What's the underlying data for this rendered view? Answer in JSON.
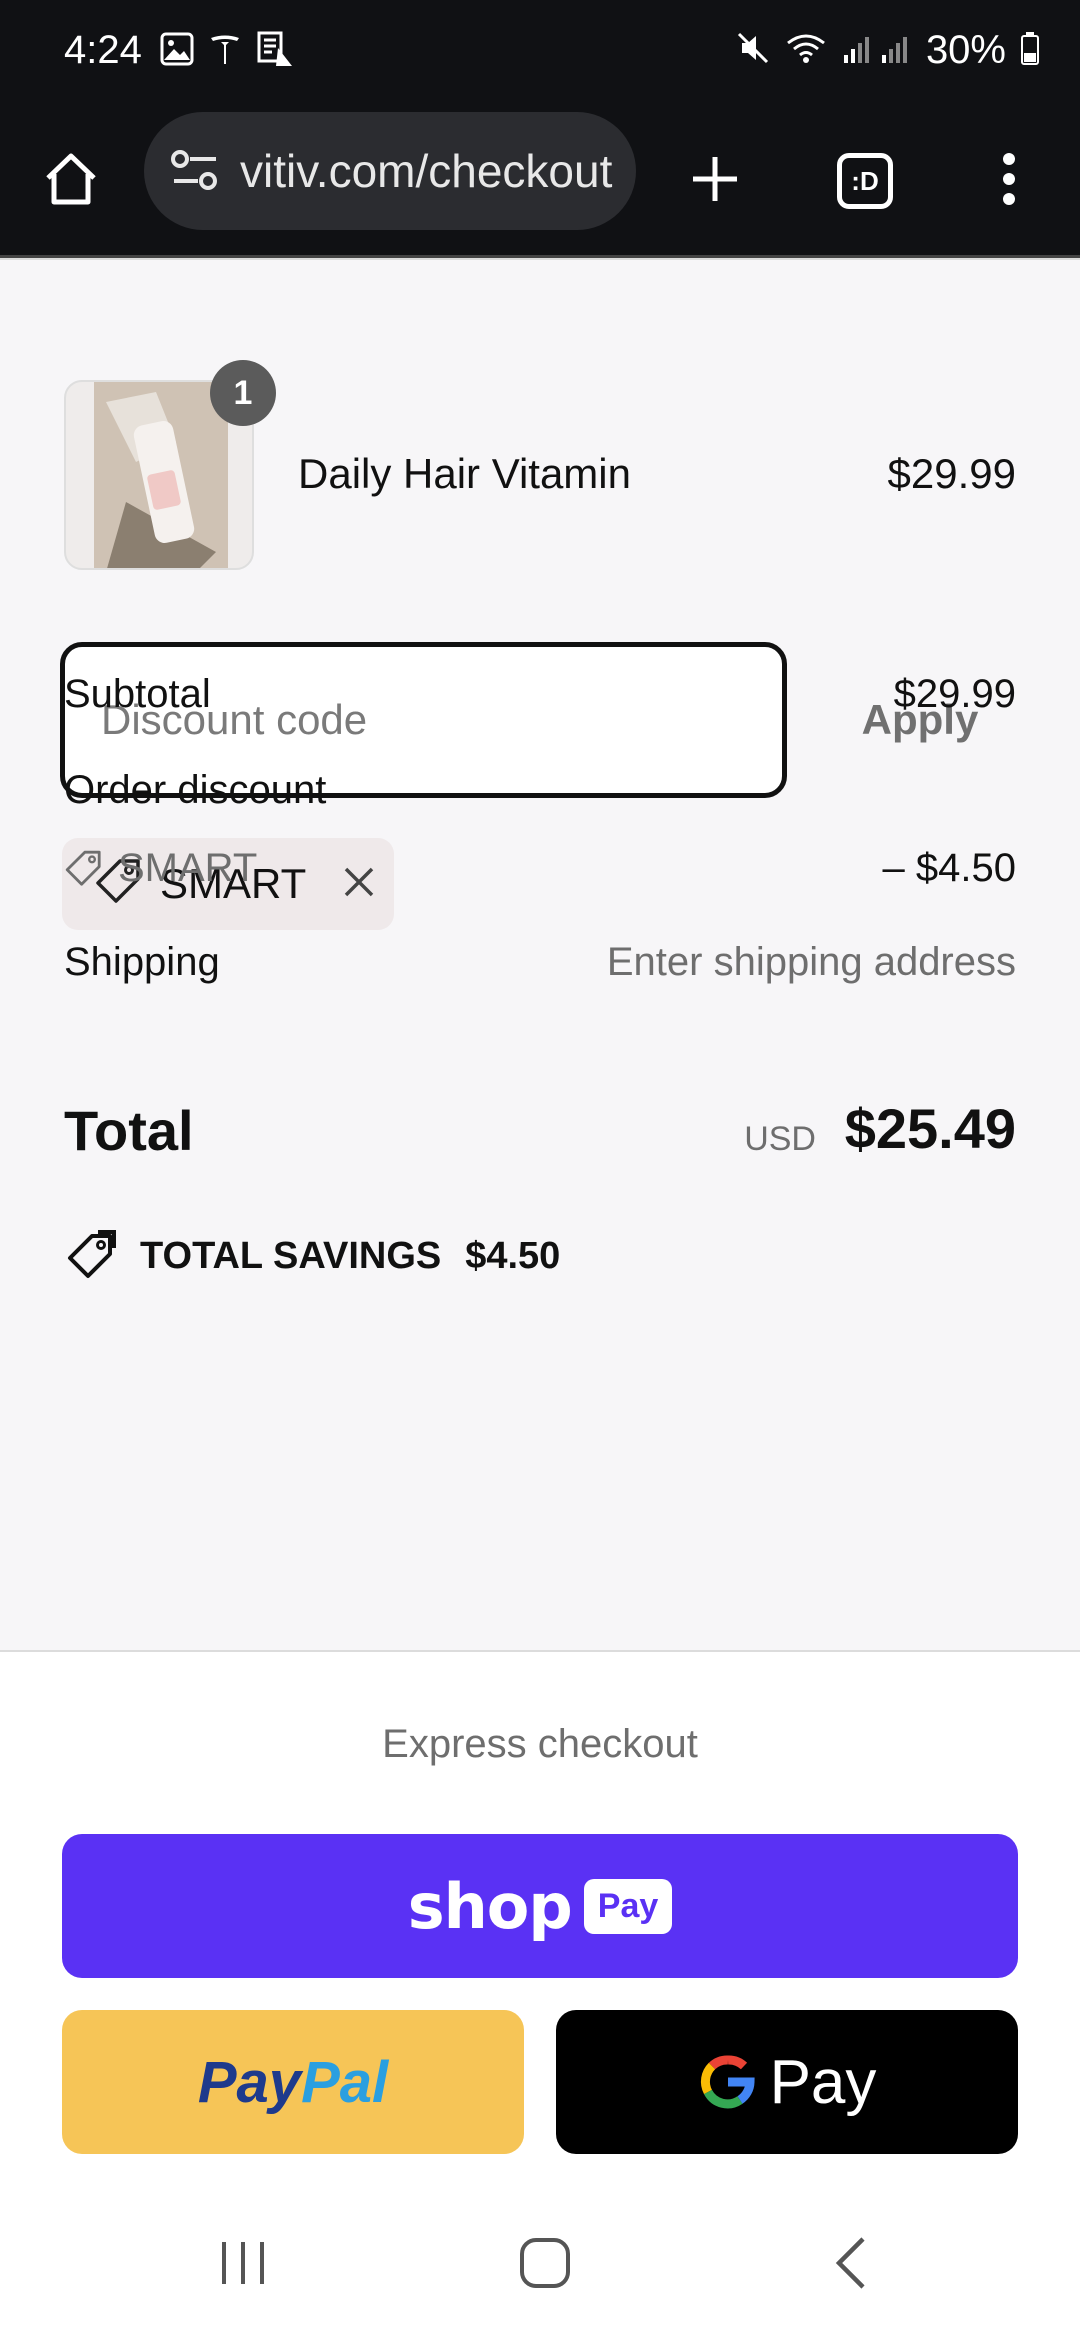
{
  "status_bar": {
    "time": "4:24",
    "battery": "30%",
    "icons": [
      "gallery-icon",
      "tesla-icon",
      "notes-icon",
      "mute-icon",
      "wifi-icon",
      "signal-icon",
      "battery-icon"
    ]
  },
  "browser": {
    "url": "vitiv.com/checkout",
    "icons": [
      "home-icon",
      "site-settings-icon",
      "new-tab-icon",
      "tab-switcher-icon",
      "more-menu-icon"
    ],
    "tab_switcher_label": ":D"
  },
  "cart": {
    "item": {
      "name": "Daily Hair Vitamin",
      "price": "$29.99",
      "quantity": "1"
    }
  },
  "discount": {
    "placeholder": "Discount code",
    "apply_label": "Apply",
    "applied_code": "SMART"
  },
  "summary": {
    "subtotal_label": "Subtotal",
    "subtotal_value": "$29.99",
    "order_discount_label": "Order discount",
    "discount_code": "SMART",
    "discount_value": "– $4.50",
    "shipping_label": "Shipping",
    "shipping_value": "Enter shipping address",
    "total_label": "Total",
    "currency": "USD",
    "total_value": "$25.49",
    "savings_label": "TOTAL SAVINGS",
    "savings_value": "$4.50"
  },
  "express": {
    "title": "Express checkout",
    "shop_pay_wordmark": "shop",
    "shop_pay_box": "Pay",
    "paypal_part1": "Pay",
    "paypal_part2": "Pal",
    "gpay_label": "Pay"
  },
  "colors": {
    "shop_pay": "#5a31f4",
    "paypal": "#f6c557",
    "gpay": "#000000"
  }
}
